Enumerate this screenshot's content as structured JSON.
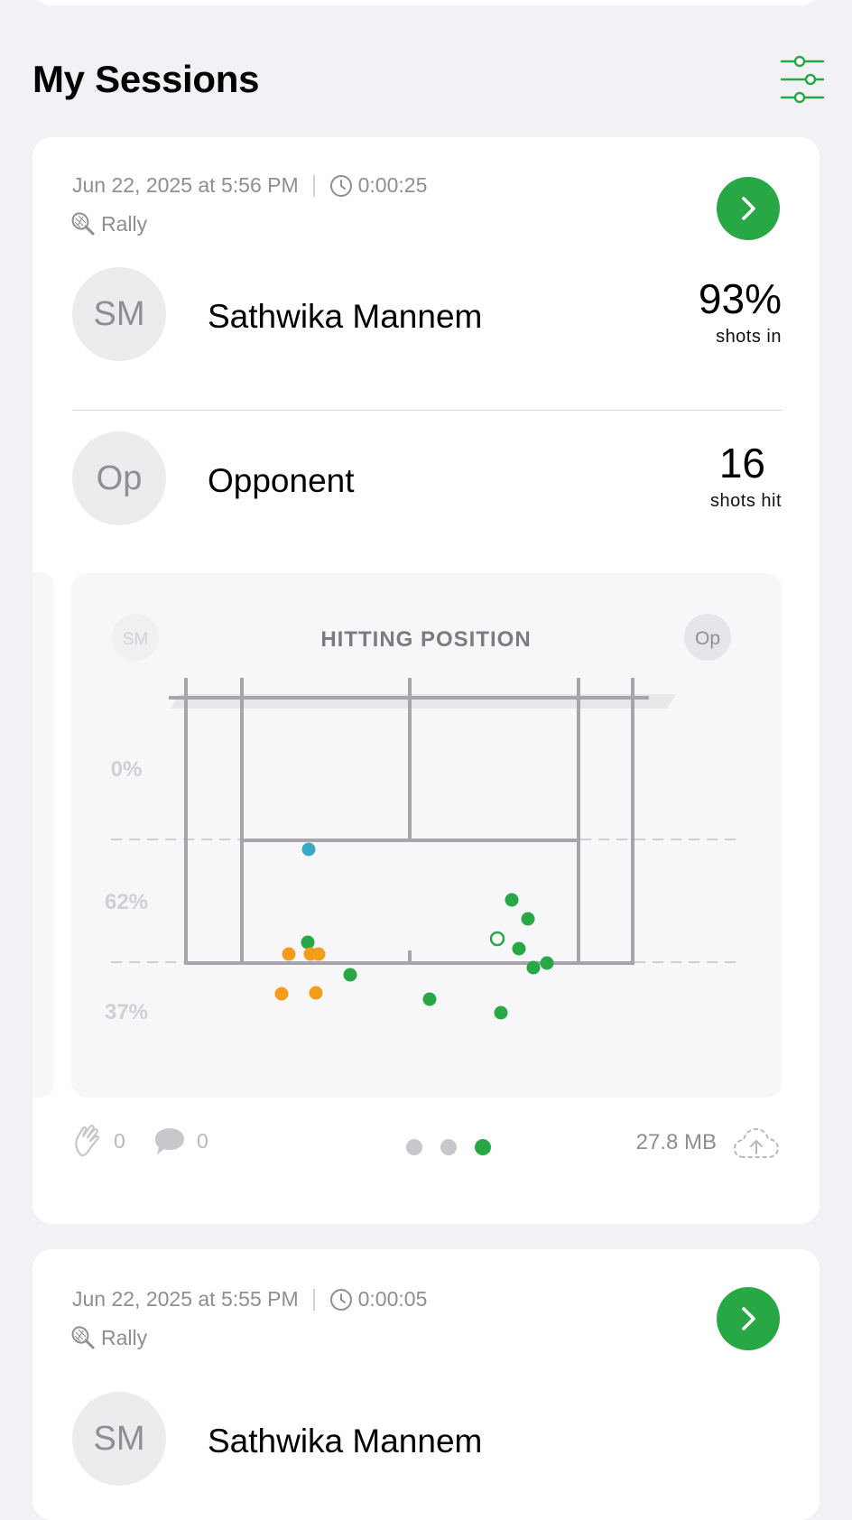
{
  "page": {
    "title": "My Sessions"
  },
  "colors": {
    "accent": "#28a745",
    "orange": "#f59c1a",
    "blue": "#3aa8c9",
    "muted": "#8e8e93"
  },
  "icons": {
    "filter": "sliders-icon",
    "clock": "clock-icon",
    "racket": "tennis-racket-icon",
    "open": "chevron-right-icon",
    "clap": "clapping-hands-icon",
    "comment": "comment-bubble-icon",
    "upload": "cloud-upload-icon"
  },
  "sessions": [
    {
      "date": "Jun 22, 2025 at 5:56 PM",
      "duration": "0:00:25",
      "type": "Rally",
      "player": {
        "initials": "SM",
        "name": "Sathwika Mannem",
        "stat_value": "93%",
        "stat_label": "shots in"
      },
      "opponent": {
        "initials": "Op",
        "name": "Opponent",
        "stat_value": "16",
        "stat_label": "shots hit"
      },
      "chart": {
        "title": "HITTING POSITION",
        "left_badge": "SM",
        "right_badge": "Op",
        "zone_labels": [
          "0%",
          "62%",
          "37%"
        ]
      },
      "claps": "0",
      "comments": "0",
      "size": "27.8 MB",
      "pager": {
        "total": 3,
        "active": 3
      }
    },
    {
      "date": "Jun 22, 2025 at 5:55 PM",
      "duration": "0:00:05",
      "type": "Rally",
      "player": {
        "initials": "SM",
        "name": "Sathwika Mannem"
      }
    }
  ],
  "chart_data": {
    "type": "scatter",
    "title": "HITTING POSITION",
    "y_zone_labels": [
      "0%",
      "62%",
      "37%"
    ],
    "series": [
      {
        "color": "green",
        "points": [
          [
            0.27,
            0.62
          ],
          [
            0.37,
            0.7
          ],
          [
            0.55,
            0.78
          ],
          [
            0.7,
            0.86
          ],
          [
            0.72,
            0.48
          ],
          [
            0.76,
            0.54
          ],
          [
            0.74,
            0.63
          ],
          [
            0.77,
            0.68
          ],
          [
            0.8,
            0.67
          ],
          [
            0.69,
            0.6
          ]
        ]
      },
      {
        "color": "orange",
        "points": [
          [
            0.23,
            0.64
          ],
          [
            0.28,
            0.64
          ],
          [
            0.3,
            0.64
          ],
          [
            0.21,
            0.74
          ],
          [
            0.29,
            0.74
          ]
        ]
      },
      {
        "color": "blue",
        "points": [
          [
            0.27,
            0.3
          ]
        ]
      }
    ]
  }
}
